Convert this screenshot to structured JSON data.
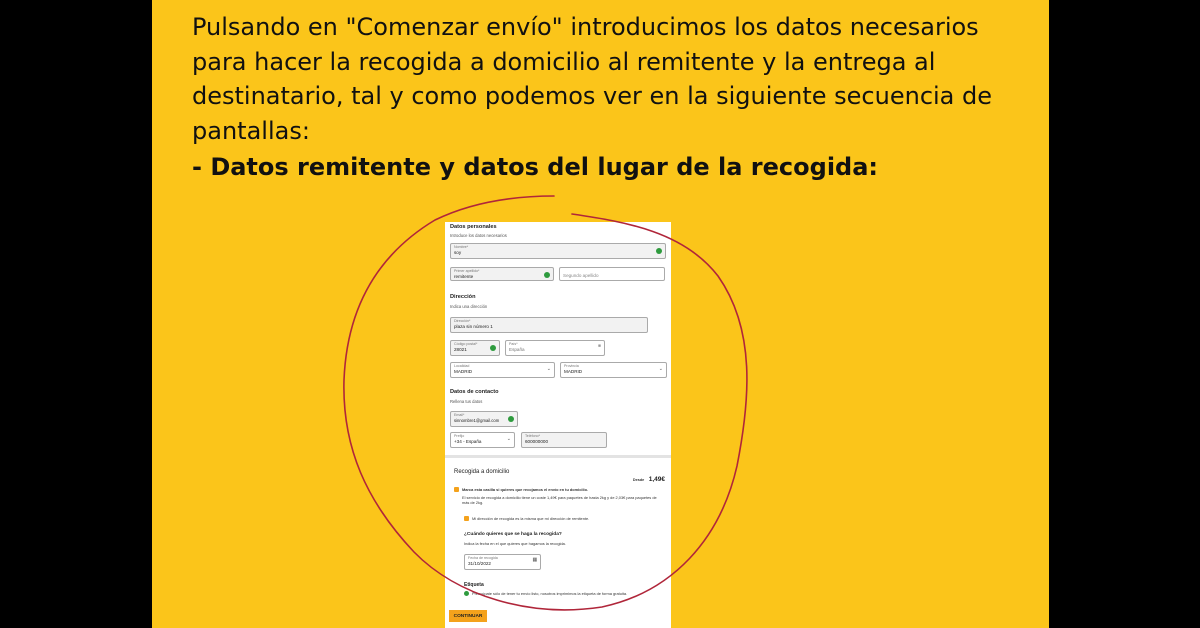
{
  "slide": {
    "intro_lines": [
      "Pulsando en \"Comenzar envío\" introducimos los datos necesarios",
      "para hacer la recogida a domicilio al remitente y la entrega al",
      "destinatario, tal y como podemos ver en la siguiente secuencia de",
      "pantallas:"
    ],
    "bold_line": "- Datos remitente y datos del lugar de la recogida:",
    "annotation_color": "#b0263a"
  },
  "form": {
    "personal": {
      "title": "Datos personales",
      "subtitle": "Introduce los datos necesarios",
      "name_label": "Nombre*",
      "name_value": "soy",
      "surname1_label": "Primer apellido*",
      "surname1_value": "remitente",
      "surname2_placeholder": "Segundo apellido"
    },
    "address": {
      "title": "Dirección",
      "subtitle": "Indica una dirección",
      "street_label": "Dirección*",
      "street_value": "plaza sin número 1",
      "postal_label": "Código postal*",
      "postal_value": "28021",
      "country_label": "País*",
      "country_value": "España",
      "city_label": "Localidad",
      "city_value": "MADRID",
      "province_label": "Provincia",
      "province_value": "MADRID"
    },
    "contact": {
      "title": "Datos de contacto",
      "subtitle": "Rellena tus datos",
      "email_label": "Email*",
      "email_value": "sinnombre1@gmail.com",
      "prefix_label": "Prefijo",
      "prefix_value": "+34 - España",
      "phone_label": "Teléfono*",
      "phone_value": "600000000"
    },
    "pickup": {
      "title": "Recogida a domicilio",
      "price_prefix": "Desde",
      "price": "1,49€",
      "check_label": "Marca esta casilla si quieres que recojamos el envío en tu domicilio.",
      "description": "El servicio de recogida a domicilio tiene un coste 1,49€ para paquetes de hasta 2kg y de 2,03€ para paquetes de más de 2kg.",
      "same_address_label": "Mi dirección de recogida es la misma que mi dirección de remitente.",
      "when_title": "¿Cuándo quieres que se haga la recogida?",
      "when_subtitle": "Indica la fecha en el que quieres que hagamos la recogida.",
      "date_label": "Fecha de recogida",
      "date_value": "31/10/2022"
    },
    "label": {
      "title": "Etiqueta",
      "text": "Preocúpate sólo de tener tu envío listo, nosotros imprimimos la etiqueta de forma gratuita."
    },
    "continue_label": "CONTINUAR"
  }
}
